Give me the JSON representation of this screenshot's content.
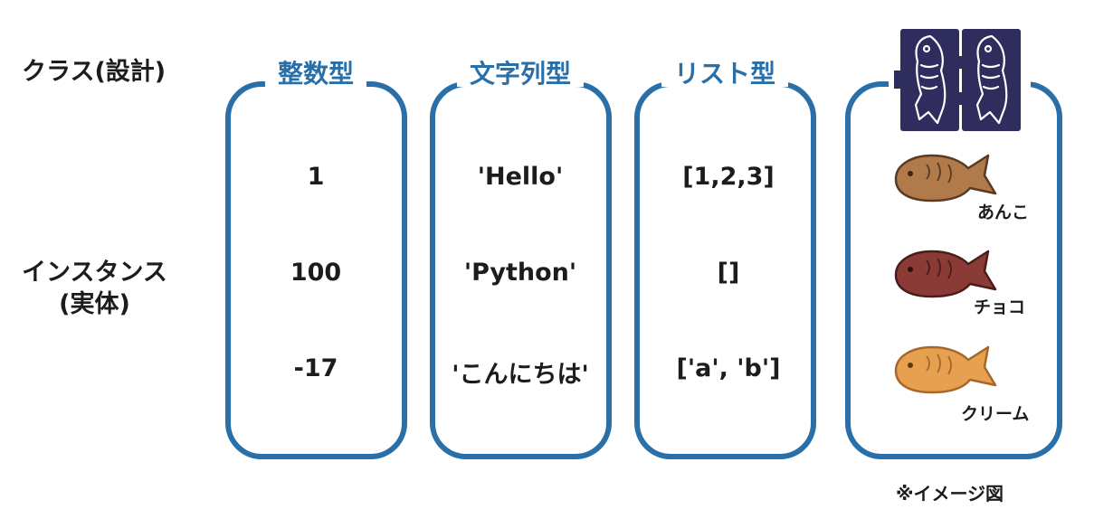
{
  "row_labels": {
    "class": "クラス(設計)",
    "instance_line1": "インスタンス",
    "instance_line2": "(実体)"
  },
  "columns": [
    {
      "title": "整数型",
      "values": [
        "1",
        "100",
        "-17"
      ]
    },
    {
      "title": "文字列型",
      "values": [
        "'Hello'",
        "'Python'",
        "'こんにちは'"
      ]
    },
    {
      "title": "リスト型",
      "values": [
        "[1,2,3]",
        "[]",
        "['a', 'b']"
      ]
    }
  ],
  "taiyaki": {
    "items": [
      {
        "label": "あんこ",
        "color": "#b07a4a"
      },
      {
        "label": "チョコ",
        "color": "#8a3b36"
      },
      {
        "label": "クリーム",
        "color": "#e6a050"
      }
    ],
    "mold_color": "#2f2c5e"
  },
  "note": "※イメージ図",
  "colors": {
    "accent": "#2a6fa8"
  }
}
